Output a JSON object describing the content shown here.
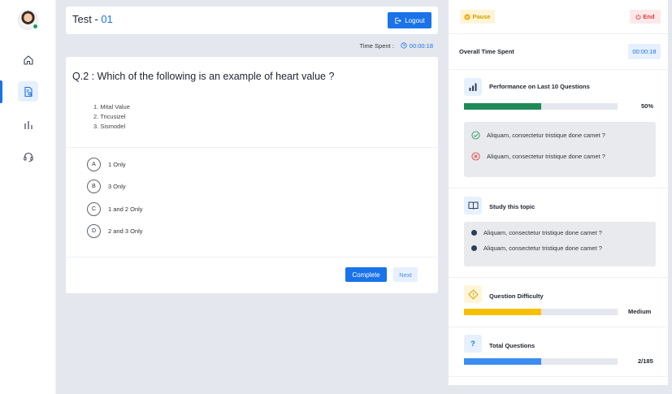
{
  "header": {
    "title_prefix": "Test",
    "title_sep": " - ",
    "title_number": "01",
    "logout_label": "Logout",
    "time_spent_label": "Time Spent :",
    "time_spent_value": "00:00:18"
  },
  "question": {
    "text": "Q.2 : Which of the following is an example of heart value ?",
    "statements": [
      "1. Mital Value",
      "2. Tricusizel",
      "3. Sismodel"
    ],
    "options": [
      {
        "letter": "A",
        "label": "1 Only"
      },
      {
        "letter": "B",
        "label": "3 Only"
      },
      {
        "letter": "C",
        "label": "1 and 2 Only"
      },
      {
        "letter": "D",
        "label": "2 and 3 Only"
      }
    ],
    "complete_label": "Complete",
    "next_label": "Next"
  },
  "panel": {
    "pause_label": "Pause",
    "end_label": "End",
    "overall_label": "Overall Time Spent",
    "overall_value": "00:00:18",
    "performance": {
      "title": "Performance on Last 10 Questions",
      "value": "50%",
      "fraction": 0.5,
      "items": [
        {
          "status": "correct",
          "text": "Aliquam, consectetur tristique done camet ?"
        },
        {
          "status": "wrong",
          "text": "Aliquam, consectetur tristique done camet ?"
        }
      ]
    },
    "study": {
      "title": "Study this topic",
      "items": [
        "Aliquam, consectetur tristique done camet ?",
        "Aliquam, consectetur tristique done camet ?"
      ]
    },
    "difficulty": {
      "title": "Question Difficulty",
      "value": "Medium",
      "fraction": 0.5
    },
    "total": {
      "title": "Total Questions",
      "icon_text": "?",
      "value": "2/185",
      "fraction": 0.5
    }
  },
  "colors": {
    "accent": "#1a73e8",
    "performance_bar": "#1f8a58",
    "difficulty_bar": "#f6c000",
    "total_bar": "#3b8ef0",
    "correct": "#2e9e5b",
    "wrong": "#e04343"
  }
}
